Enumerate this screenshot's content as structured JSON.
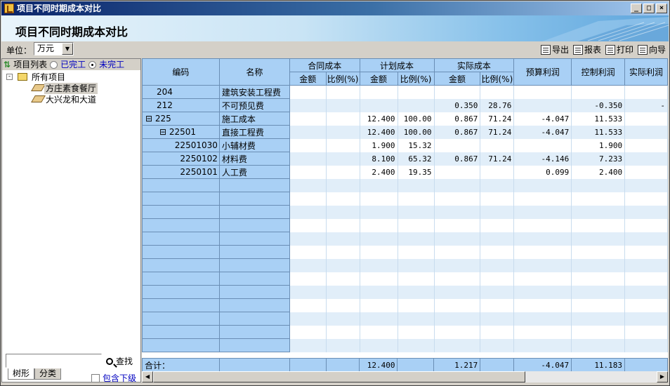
{
  "window": {
    "title": "项目不同时期成本对比",
    "buttons": {
      "min": "_",
      "max": "□",
      "close": "×"
    }
  },
  "banner": {
    "title": "项目不同时期成本对比"
  },
  "toolbar": {
    "unit_label": "单位：",
    "unit_value": "万元",
    "export": "导出",
    "report": "报表",
    "print": "打印",
    "wizard": "向导"
  },
  "left": {
    "list_label": "项目列表",
    "opt_done": "已完工",
    "opt_undone": "未完工",
    "root": "所有项目",
    "items": [
      "方庄素食餐厅",
      "大兴龙和大道"
    ],
    "find": "查找",
    "tab_tree": "树形",
    "tab_class": "分类",
    "include_sub": "包含下级"
  },
  "grid": {
    "headers": {
      "code": "编码",
      "name": "名称",
      "contract": "合同成本",
      "plan": "计划成本",
      "actual": "实际成本",
      "budget_profit": "预算利润",
      "control_profit": "控制利润",
      "actual_profit": "实际利润",
      "amount": "金额",
      "ratio": "比例(%)"
    },
    "rows": [
      {
        "code": "204",
        "name": "建筑安装工程费",
        "c_amt": "",
        "c_ratio": "",
        "p_amt": "",
        "p_ratio": "",
        "a_amt": "",
        "a_ratio": "",
        "bp": "",
        "cp": "",
        "ap": ""
      },
      {
        "code": "212",
        "name": "不可预见费",
        "c_amt": "",
        "c_ratio": "",
        "p_amt": "",
        "p_ratio": "",
        "a_amt": "0.350",
        "a_ratio": "28.76",
        "bp": "",
        "cp": "-0.350",
        "ap": "-"
      },
      {
        "code": "⊟ 225",
        "name": "施工成本",
        "c_amt": "",
        "c_ratio": "",
        "p_amt": "12.400",
        "p_ratio": "100.00",
        "a_amt": "0.867",
        "a_ratio": "71.24",
        "bp": "-4.047",
        "cp": "11.533",
        "ap": ""
      },
      {
        "code": "⊟ 22501",
        "name": "直接工程费",
        "c_amt": "",
        "c_ratio": "",
        "p_amt": "12.400",
        "p_ratio": "100.00",
        "a_amt": "0.867",
        "a_ratio": "71.24",
        "bp": "-4.047",
        "cp": "11.533",
        "ap": ""
      },
      {
        "code": "22501030",
        "name": "小辅材费",
        "c_amt": "",
        "c_ratio": "",
        "p_amt": "1.900",
        "p_ratio": "15.32",
        "a_amt": "",
        "a_ratio": "",
        "bp": "",
        "cp": "1.900",
        "ap": ""
      },
      {
        "code": "2250102",
        "name": "材料费",
        "c_amt": "",
        "c_ratio": "",
        "p_amt": "8.100",
        "p_ratio": "65.32",
        "a_amt": "0.867",
        "a_ratio": "71.24",
        "bp": "-4.146",
        "cp": "7.233",
        "ap": ""
      },
      {
        "code": "2250101",
        "name": "人工费",
        "c_amt": "",
        "c_ratio": "",
        "p_amt": "2.400",
        "p_ratio": "19.35",
        "a_amt": "",
        "a_ratio": "",
        "bp": "0.099",
        "cp": "2.400",
        "ap": ""
      }
    ],
    "totals": {
      "label": "合计：",
      "c_amt": "",
      "c_ratio": "",
      "p_amt": "12.400",
      "p_ratio": "",
      "a_amt": "1.217",
      "a_ratio": "",
      "bp": "-4.047",
      "cp": "11.183",
      "ap": ""
    }
  }
}
